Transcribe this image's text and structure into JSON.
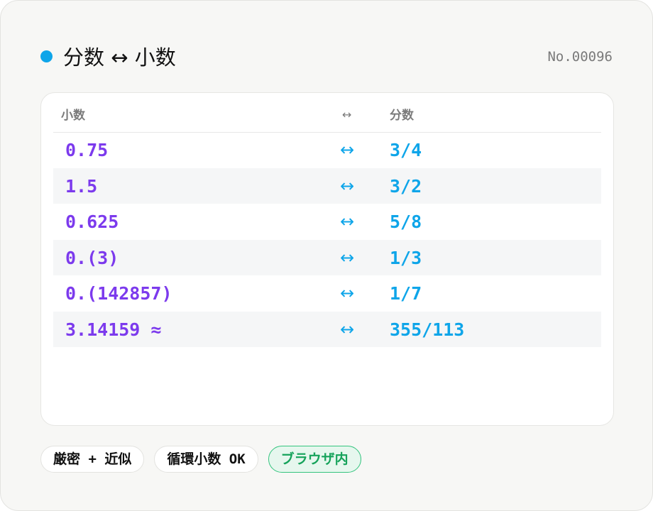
{
  "header": {
    "title": "分数 ↔ 小数",
    "record_no": "No.00096",
    "accent_color": "#0ea5e9"
  },
  "table": {
    "columns": {
      "decimal": "小数",
      "arrow": "↔",
      "fraction": "分数"
    },
    "rows": [
      {
        "decimal": "0.75",
        "arrow": "↔",
        "fraction": "3/4"
      },
      {
        "decimal": "1.5",
        "arrow": "↔",
        "fraction": "3/2"
      },
      {
        "decimal": "0.625",
        "arrow": "↔",
        "fraction": "5/8"
      },
      {
        "decimal": "0.(3)",
        "arrow": "↔",
        "fraction": "1/3"
      },
      {
        "decimal": "0.(142857)",
        "arrow": "↔",
        "fraction": "1/7"
      },
      {
        "decimal": "3.14159 ≈",
        "arrow": "↔",
        "fraction": "355/113"
      }
    ],
    "decimal_color": "#7c3aed",
    "fraction_color": "#0ea5e9"
  },
  "chips": [
    {
      "label": "厳密 + 近似"
    },
    {
      "label": "循環小数 OK"
    },
    {
      "label": "ブラウザ内",
      "accent_color": "#16a35b"
    }
  ]
}
